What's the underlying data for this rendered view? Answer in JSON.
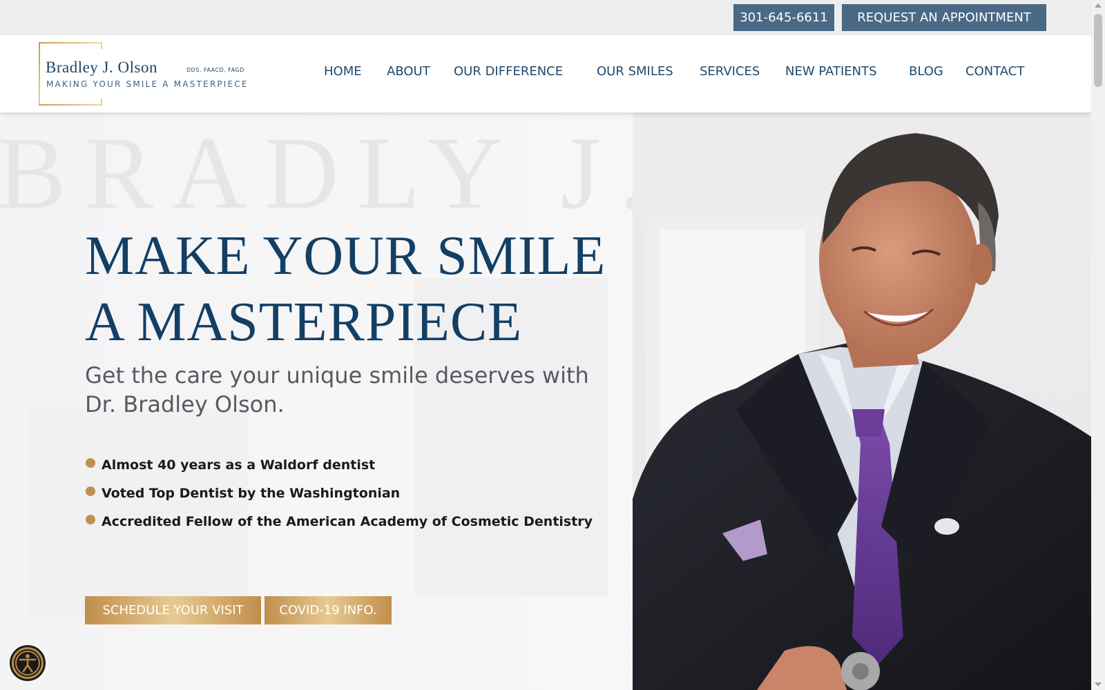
{
  "topbar": {
    "phone": "301-645-6611",
    "appointment": "REQUEST AN APPOINTMENT"
  },
  "logo": {
    "name": "Bradley J. Olson",
    "credentials": "DDS, FAACD, FAGD",
    "tagline": "MAKING YOUR SMILE A MASTERPIECE"
  },
  "nav": {
    "items": [
      {
        "label": "HOME"
      },
      {
        "label": "ABOUT"
      },
      {
        "label": "OUR DIFFERENCE"
      },
      {
        "label": "OUR SMILES"
      },
      {
        "label": "SERVICES"
      },
      {
        "label": "NEW PATIENTS"
      },
      {
        "label": "BLOG"
      },
      {
        "label": "CONTACT"
      }
    ]
  },
  "hero": {
    "watermark": "BRADLY J. OLSON",
    "headline_line1": "MAKE YOUR SMILE",
    "headline_line2": "A MASTERPIECE",
    "subhead": "Get the care your unique smile deserves with Dr. Bradley Olson.",
    "bullets": [
      "Almost 40 years as a Waldorf dentist",
      "Voted Top Dentist by the Washingtonian",
      "Accredited Fellow of the American Academy of Cosmetic Dentistry"
    ],
    "cta_schedule": "SCHEDULE YOUR VISIT",
    "cta_covid": "COVID-19 INFO."
  },
  "icons": {
    "accessibility": "accessibility-icon",
    "bullet": "bullet-dot-icon"
  },
  "colors": {
    "navy": "#143f64",
    "nav_text": "#204a6e",
    "topbar_button": "#4a6985",
    "gold": "#c18e4c",
    "gold_light": "#e6ca93"
  }
}
